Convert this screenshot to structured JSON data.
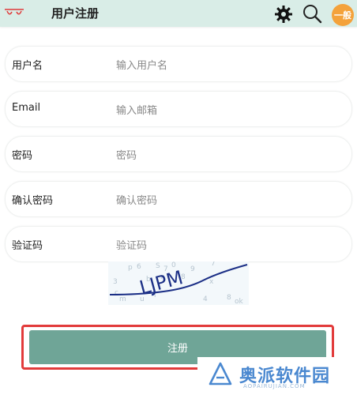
{
  "header": {
    "title": "用户注册",
    "level_badge": "一般"
  },
  "form": {
    "fields": [
      {
        "label": "用户名",
        "placeholder": "输入用户名"
      },
      {
        "label": "Email",
        "placeholder": "输入邮箱"
      },
      {
        "label": "密码",
        "placeholder": "密码"
      },
      {
        "label": "确认密码",
        "placeholder": "确认密码"
      },
      {
        "label": "验证码",
        "placeholder": "验证码"
      }
    ],
    "captcha_text": "LJPM",
    "submit_label": "注册"
  },
  "watermark": {
    "brand": "奥派软件园",
    "url": "AOPAIRUJIAN.COM"
  },
  "colors": {
    "header_bg": "#d9ede7",
    "button": "#6fa597",
    "highlight": "#e23b3b",
    "badge": "#f4a23b"
  }
}
